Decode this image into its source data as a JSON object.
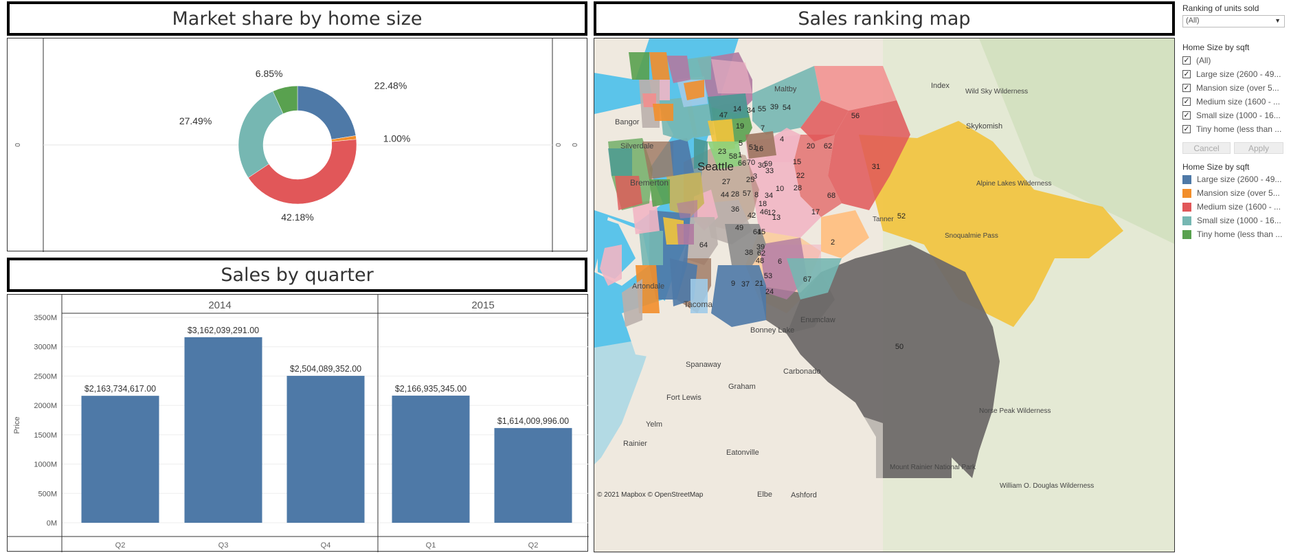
{
  "titles": {
    "market_share": "Market share by home size",
    "sales_map": "Sales ranking map",
    "sales_quarter": "Sales by quarter"
  },
  "donut": {
    "left_axis_label": "0",
    "right_axis_label_1": "0",
    "right_axis_label_2": "0"
  },
  "bar": {
    "years": [
      "2014",
      "2015"
    ],
    "ylabel": "Price"
  },
  "map": {
    "labels": {
      "seattle": "Seattle",
      "bremerton": "Bremerton",
      "tacoma": "Tacoma",
      "bonney_lake": "Bonney Lake",
      "enumclaw": "Enumclaw",
      "silverdale": "Silverdale",
      "bangor": "Bangor",
      "index": "Index",
      "skykomish": "Skykomish",
      "maltby": "Maltby",
      "spanaway": "Spanaway",
      "graham": "Graham",
      "carbonado": "Carbonado",
      "fort_lewis": "Fort Lewis",
      "yelm": "Yelm",
      "rainier": "Rainier",
      "eatonville": "Eatonville",
      "elbe": "Elbe",
      "ashford": "Ashford",
      "artondale": "Artondale",
      "wild_sky": "Wild Sky\nWilderness",
      "alpine_lakes": "Alpine Lakes\nWilderness",
      "norse_peak": "Norse Peak\nWilderness",
      "mount_rainier": "Mount Rainier\nNational Park",
      "william_douglas": "William O. Douglas\nWilderness",
      "snoqualmie_pass": "Snoqualmie\nPass",
      "tanner": "Tanner",
      "attribution": "© 2021 Mapbox  © OpenStreetMap"
    },
    "regions": [
      {
        "id": "50",
        "color": "#6e6a69"
      },
      {
        "id": "52",
        "color": "#f2c33c"
      },
      {
        "id": "31",
        "color": "#e15759"
      },
      {
        "id": "56",
        "color": "#f28e8e"
      },
      {
        "id": "68",
        "color": "#e15759"
      },
      {
        "id": "17",
        "color": "#f1b6c4"
      },
      {
        "id": "24",
        "color": "#4e79a7"
      },
      {
        "id": "64",
        "color": "#f1b6c4"
      }
    ]
  },
  "controls": {
    "ranking_title": "Ranking of units sold",
    "ranking_value": "(All)",
    "filter_title": "Home Size by sqft",
    "filter_items": [
      "(All)",
      "Large size (2600 - 49...",
      "Mansion size (over 5...",
      "Medium size (1600 - ...",
      "Small size (1000 - 16...",
      "Tiny home (less than ..."
    ],
    "cancel_label": "Cancel",
    "apply_label": "Apply",
    "legend_title": "Home Size by sqft",
    "legend_items": [
      {
        "label": "Large size (2600 - 49...",
        "color": "#4e79a7"
      },
      {
        "label": "Mansion size (over 5...",
        "color": "#f28e2b"
      },
      {
        "label": "Medium size (1600 - ...",
        "color": "#e15759"
      },
      {
        "label": "Small size (1000 - 16...",
        "color": "#76b7b2"
      },
      {
        "label": "Tiny home (less than ...",
        "color": "#59a14f"
      }
    ]
  },
  "chart_data": [
    {
      "type": "pie",
      "title": "Market share by home size",
      "series": [
        {
          "name": "Large size (2600 - 49...",
          "value": 22.48,
          "label": "22.48%",
          "color": "#4e79a7"
        },
        {
          "name": "Mansion size (over 5...",
          "value": 1.0,
          "label": "1.00%",
          "color": "#f28e2b"
        },
        {
          "name": "Medium size (1600 - ...",
          "value": 42.18,
          "label": "42.18%",
          "color": "#e15759"
        },
        {
          "name": "Small size (1000 - 16...",
          "value": 27.49,
          "label": "27.49%",
          "color": "#76b7b2"
        },
        {
          "name": "Tiny home (less than ...",
          "value": 6.85,
          "label": "6.85%",
          "color": "#59a14f"
        }
      ]
    },
    {
      "type": "bar",
      "title": "Sales by quarter",
      "ylabel": "Price",
      "ylim": [
        0,
        3500
      ],
      "yticks": [
        0,
        500,
        1000,
        1500,
        2000,
        2500,
        3000,
        3500
      ],
      "ytick_labels": [
        "0M",
        "500M",
        "1000M",
        "1500M",
        "2000M",
        "2500M",
        "3000M",
        "3500M"
      ],
      "bar_color": "#4e79a7",
      "categories": [
        {
          "year": "2014",
          "quarter": "Q2",
          "value": 2163.734617,
          "label": "$2,163,734,617.00"
        },
        {
          "year": "2014",
          "quarter": "Q3",
          "value": 3162.039291,
          "label": "$3,162,039,291.00"
        },
        {
          "year": "2014",
          "quarter": "Q4",
          "value": 2504.089352,
          "label": "$2,504,089,352.00"
        },
        {
          "year": "2015",
          "quarter": "Q1",
          "value": 2166.935345,
          "label": "$2,166,935,345.00"
        },
        {
          "year": "2015",
          "quarter": "Q2",
          "value": 1614.009996,
          "label": "$1,614,009,996.00"
        }
      ]
    }
  ]
}
